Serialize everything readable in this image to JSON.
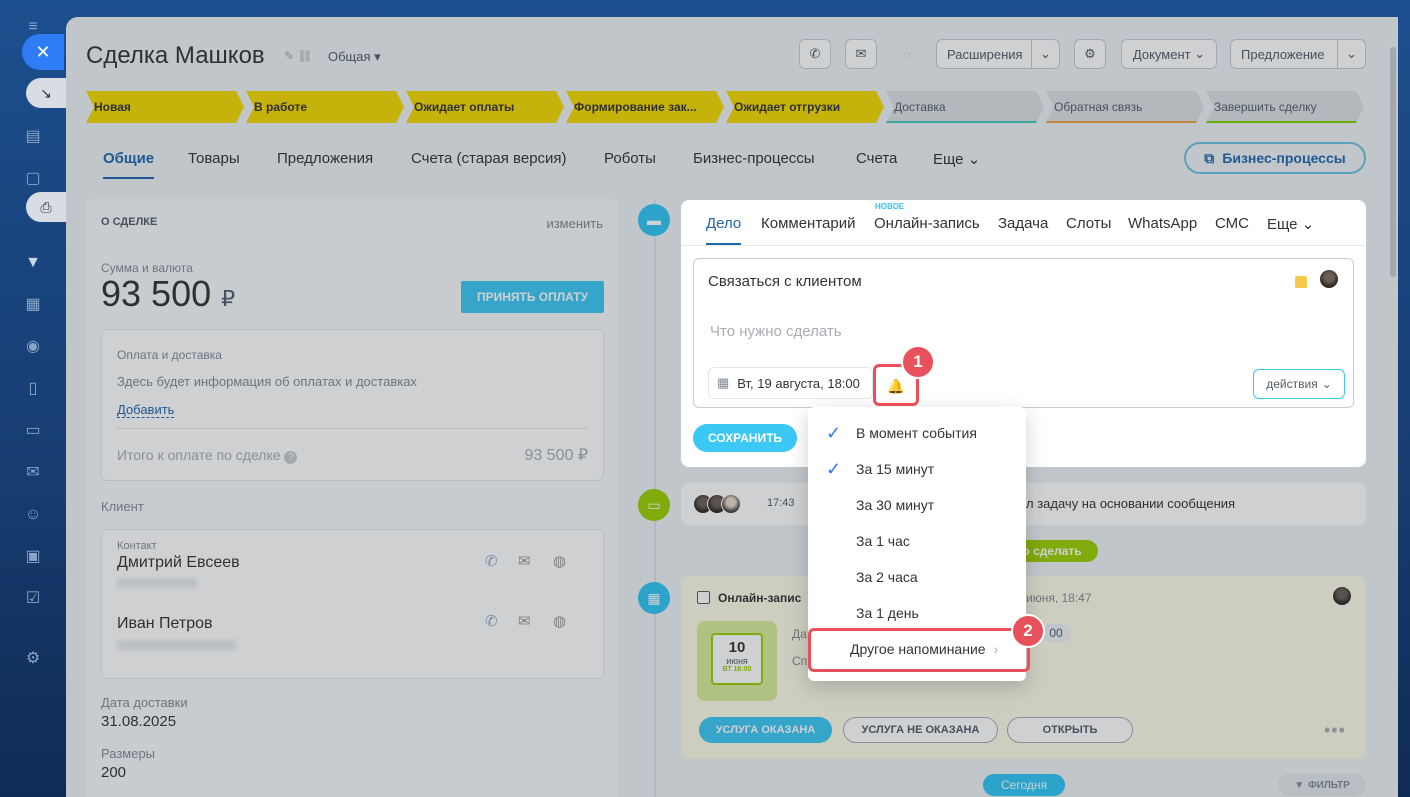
{
  "deal": {
    "title": "Сделка Машков",
    "category": "Общая"
  },
  "toolbar": {
    "extensions": "Расширения",
    "document": "Документ",
    "offer": "Предложение"
  },
  "stages": [
    "Новая",
    "В работе",
    "Ожидает оплаты",
    "Формирование зак...",
    "Ожидает отгрузки",
    "Доставка",
    "Обратная связь",
    "Завершить сделку"
  ],
  "tabs": [
    "Общие",
    "Товары",
    "Предложения",
    "Счета (старая версия)",
    "Роботы",
    "Бизнес-процессы",
    "Счета",
    "Еще"
  ],
  "bp_button": "Бизнес-процессы",
  "about": {
    "header": "О СДЕЛКЕ",
    "edit": "изменить",
    "sum_label": "Сумма и валюта",
    "sum": "93 500",
    "currency": "₽",
    "accept": "ПРИНЯТЬ ОПЛАТУ",
    "pay_title": "Оплата и доставка",
    "pay_info": "Здесь будет информация об оплатах и доставках",
    "pay_add": "Добавить",
    "total_label": "Итого к оплате по сделке",
    "total_value": "93 500 ₽",
    "client_label": "Клиент",
    "contact_label": "Контакт",
    "contact1": "Дмитрий Евсеев",
    "contact2": "Иван Петров",
    "delivery_label": "Дата доставки",
    "delivery_value": "31.08.2025",
    "size_label": "Размеры",
    "size_value": "200"
  },
  "editor": {
    "tabs": [
      "Дело",
      "Комментарий",
      "Онлайн-запись",
      "Задача",
      "Слоты",
      "WhatsApp",
      "СМС",
      "Еще"
    ],
    "new_badge": "НОВОЕ",
    "task_title": "Связаться с клиентом",
    "placeholder": "Что нужно сделать",
    "date": "Вт, 19 августа, 18:00",
    "actions": "действия",
    "save": "СОХРАНИТЬ"
  },
  "feed": {
    "time": "17:43",
    "text": "л задачу на основании сообщения",
    "todo_pill": "о сделать",
    "booking_title": "Онлайн-запис",
    "booking_date": "июня, 18:47",
    "cal_day": "10",
    "cal_month": "июня",
    "cal_time": "ВТ 16:00",
    "frag1": "Да",
    "frag2": "Сп",
    "frag3": "00",
    "btn_done": "УСЛУГА ОКАЗАНА",
    "btn_not_done": "УСЛУГА НЕ ОКАЗАНА",
    "btn_open": "ОТКРЫТЬ",
    "today": "Сегодня",
    "filter": "ФИЛЬТР"
  },
  "reminders": [
    {
      "label": "В момент события",
      "checked": true
    },
    {
      "label": "За 15 минут",
      "checked": true
    },
    {
      "label": "За 30 минут",
      "checked": false
    },
    {
      "label": "За 1 час",
      "checked": false
    },
    {
      "label": "За 2 часа",
      "checked": false
    },
    {
      "label": "За 1 день",
      "checked": false
    },
    {
      "label": "Другое напоминание",
      "checked": false
    }
  ],
  "badges": {
    "one": "1",
    "two": "2"
  },
  "colors": {
    "accent": "#2e7cf6",
    "stage_active": "#f4d900",
    "highlight": "#e8505b",
    "button": "#3bc8f5"
  }
}
